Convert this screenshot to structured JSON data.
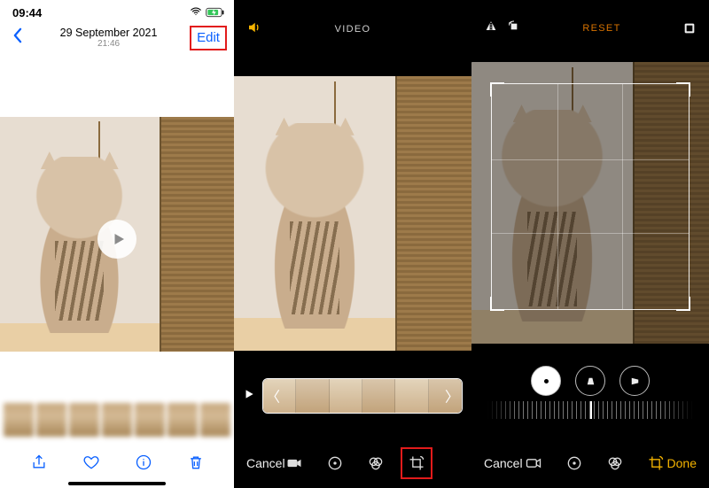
{
  "screen1": {
    "status": {
      "time": "09:44",
      "wifi": "wifi-icon",
      "battery": "battery-icon"
    },
    "nav": {
      "date": "29 September 2021",
      "time": "21:46",
      "edit_label": "Edit"
    },
    "toolbar": {
      "share": "share-icon",
      "favorite": "heart-icon",
      "info": "info-icon",
      "delete": "trash-icon"
    }
  },
  "screen2": {
    "mode_label": "VIDEO",
    "volume_icon": "volume-icon",
    "cancel_label": "Cancel",
    "tools": {
      "video": "video-icon",
      "adjust": "adjust-icon",
      "filters": "filters-icon",
      "crop": "crop-icon"
    }
  },
  "screen3": {
    "reset_label": "RESET",
    "flip_icon": "flip-icon",
    "rotate_icon": "rotate-icon",
    "aspect_icon": "aspect-icon",
    "rot_buttons": {
      "straighten": "straighten-icon",
      "vertical": "vertical-skew-icon",
      "horizontal": "horizontal-skew-icon"
    },
    "cancel_label": "Cancel",
    "done_label": "Done",
    "tools": {
      "video": "video-icon",
      "adjust": "adjust-icon",
      "filters": "filters-icon",
      "crop": "crop-icon"
    }
  },
  "colors": {
    "ios_blue": "#0a60ff",
    "ios_yellow": "#f5b400",
    "ios_orange": "#d97300",
    "highlight_red": "#e21b1b"
  }
}
